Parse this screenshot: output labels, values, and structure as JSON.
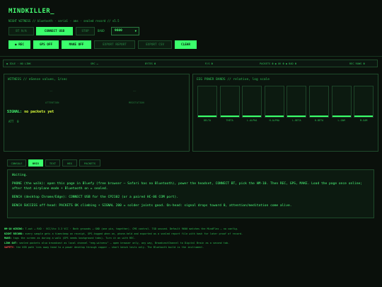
{
  "app": {
    "title": "MINDKILLER_",
    "subtitle": "NIGHT WITNESS // bluetooth · serial · ams · sealed record // v5.5"
  },
  "toolbar": {
    "bt_label": "BT N/A",
    "connect_usb_label": "CONNECT USB",
    "stop_label": "STOP",
    "baud_label": "BAUD",
    "baud_value": "9600",
    "rec_label": "● REC",
    "gps_label": "GPS OFF",
    "make_off_label": "MAKE OFF",
    "export_report_label": "EXPORT REPORT",
    "export_csv_label": "EXPORT CSV",
    "clear_label": "CLEAR"
  },
  "status": {
    "mode": "◉ IDLE · NO LINK",
    "src_label": "SRC",
    "src_value": "—",
    "bytes_label": "BYTES",
    "bytes_value": "0",
    "pps_label": "P/S",
    "pps_value": "0",
    "packets_label": "PACKETS",
    "packets_value": "0",
    "ok_label": "OK",
    "ok_value": "0",
    "bad_label": "BAD",
    "bad_value": "0",
    "rec_rows_label": "REC ROWS",
    "rec_rows_value": "0"
  },
  "witness": {
    "title": "WITNESS // eSense values, 1/sec",
    "attention_value": "——",
    "attention_label": "ATTENTION",
    "meditation_value": "——",
    "meditation_label": "MEDITATION",
    "signal_label": "SIGNAL:",
    "signal_value": "no packets yet",
    "att_label": "ATT",
    "att_value": "0"
  },
  "bands": {
    "title": "EEG POWER BANDS // relative, log scale",
    "items": [
      {
        "label": "DELTA",
        "level": 0.04
      },
      {
        "label": "THETA",
        "level": 0.04
      },
      {
        "label": "L-ALPHA",
        "level": 0.04
      },
      {
        "label": "H-ALPHA",
        "level": 0.04
      },
      {
        "label": "L-BETA",
        "level": 0.04
      },
      {
        "label": "H-BETA",
        "level": 0.04
      },
      {
        "label": "L-GAM",
        "level": 0.04
      },
      {
        "label": "M-GAM",
        "level": 0.04
      }
    ]
  },
  "tabs": [
    "CONSOLE",
    "BRIX",
    "TEXT",
    "HEX",
    "PACKETS"
  ],
  "console": {
    "lines": [
      "Waiting.",
      "PHONE (the walk): open this page in Bluefy (free browser — Safari has no Bluetooth), power the headset, CONNECT BT, pick the HM-10. Then REC, GPS, MAKE. Load the page once online; after that airplane mode + Bluetooth on = sealed.",
      "BENCH (desktop Chrome/Edge): CONNECT USB for the CP2102 (or a paired HC-06 COM port).",
      "BENCH SUCCESS off-head: PACKETS OK climbing + SIGNAL 200 = solder joints good. On-head: signal drops toward 0, attention/meditation come alive."
    ]
  },
  "notes": [
    {
      "key": "HM-10 WIRING:",
      "text": "T-out → RXD · VCC/Vcc 3.3 VCC · Both grounds → GND (one pin, together). CMS control. TXD unused. Default 9600 matches the MindFlex — no config."
    },
    {
      "key": "NIGHT RECORD:",
      "text": "every sample gets a timestamp on receipt, GPS-tagged when on, phone-held and exported as a sealed report file with hash for later proof of record."
    },
    {
      "key": "MAKE:",
      "text": "tags the screen as during a walk (GPS needs background tabs). Turn it on with REC."
    },
    {
      "key": "LINK OUT:",
      "text": "sealed packets also broadcast as local channel \"eeg-witness\" — open browser only, any way, BroadcastChannel to Digital Brain as a second tab."
    },
    {
      "key": "SAFETY:",
      "text": "the USB path lies away head to a power desktop through copper — short bench tests only. The Bluetooth build is the instrument."
    }
  ]
}
